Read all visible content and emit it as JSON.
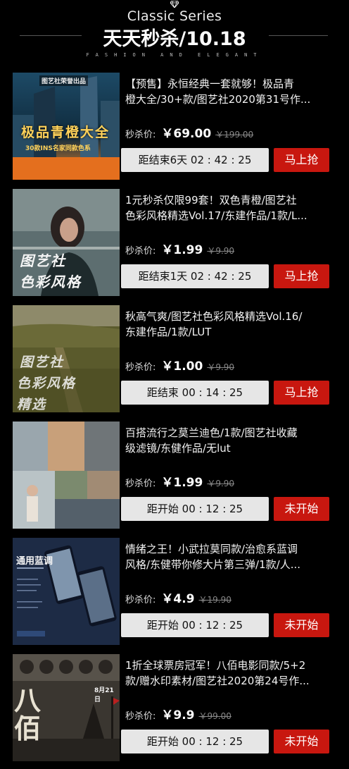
{
  "header": {
    "series": "Classic Series",
    "title": "天天秒杀/10.18",
    "tagline": "FASHION AND ELEGANT"
  },
  "price_label": "秒杀价:",
  "products": [
    {
      "line1": "【预售】永恒经典一套就够！极品青",
      "line2": "橙大全/30+款/图艺社2020第31号作...",
      "price": "￥69.00",
      "old_price": "￥199.00",
      "timer": "距结束6天 02 : 42 : 25",
      "button": "马上抢",
      "thumb_badge": "图艺社荣誉出品",
      "thumb_title": "极品青橙大全",
      "thumb_sub": "30款INS名家同款色系"
    },
    {
      "line1": "1元秒杀仅限99套！双色青橙/图艺社",
      "line2": "色彩风格精选Vol.17/东建作品/1款/L...",
      "price": "￥1.99",
      "old_price": "￥9.90",
      "timer": "距结束1天 02 : 42 : 25",
      "button": "马上抢",
      "thumb_line1": "图艺社",
      "thumb_line2": "色彩风格"
    },
    {
      "line1": "秋高气爽/图艺社色彩风格精选Vol.16/",
      "line2": "东建作品/1款/LUT",
      "price": "￥1.00",
      "old_price": "￥9.90",
      "timer": "距结束 00 : 14 : 25",
      "button": "马上抢",
      "thumb_line1": "图艺社",
      "thumb_line2": "色彩风格",
      "thumb_line3": "精选"
    },
    {
      "line1": "百搭流行之莫兰迪色/1款/图艺社收藏",
      "line2": "级滤镜/东健作品/无lut",
      "price": "￥1.99",
      "old_price": "￥9.90",
      "timer": "距开始 00 : 12 : 25",
      "button": "未开始"
    },
    {
      "line1": "情绪之王！小武拉莫同款/治愈系蓝调",
      "line2": "风格/东健带你修大片第三弹/1款/人...",
      "price": "￥4.9",
      "old_price": "￥19.90",
      "timer": "距开始 00 : 12 : 25",
      "button": "未开始",
      "thumb_title": "通用蓝调"
    },
    {
      "line1": "1折全球票房冠军！八佰电影同款/5+2",
      "line2": "款/赠水印素材/图艺社2020第24号作...",
      "price": "￥9.9",
      "old_price": "￥99.00",
      "timer": "距开始 00 : 12 : 25",
      "button": "未开始",
      "thumb_title": "八佰",
      "thumb_date": "8月21日"
    }
  ],
  "colors": {
    "button_red": "#c8170f",
    "timer_bg": "#e6e6e6",
    "background": "#000000"
  }
}
